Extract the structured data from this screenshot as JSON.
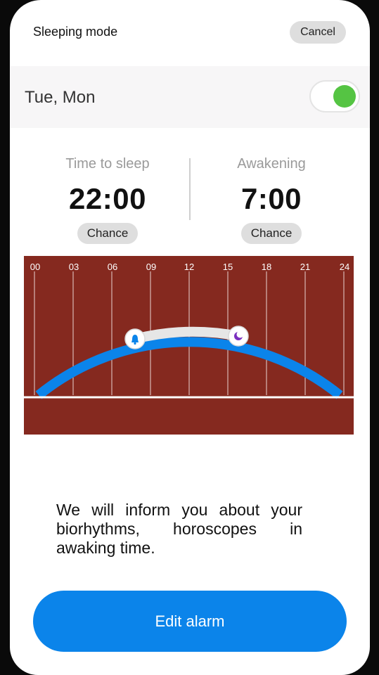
{
  "header": {
    "title": "Sleeping mode",
    "cancel_label": "Cancel"
  },
  "schedule": {
    "days": "Tue, Mon",
    "enabled": true,
    "toggle_color": "#55c443"
  },
  "sleep": {
    "label": "Time to sleep",
    "time": "22:00",
    "button_label": "Chance"
  },
  "wake": {
    "label": "Awakening",
    "time": "7:00",
    "button_label": "Chance"
  },
  "timeline": {
    "hour_labels": [
      "00",
      "03",
      "06",
      "09",
      "12",
      "15",
      "18",
      "21",
      "24"
    ],
    "background_color": "#85291f",
    "arc_color": "#0b84ea",
    "sleep_segment_color": "#e6e6e6",
    "markers": [
      {
        "icon": "bell-icon",
        "color": "#0b84ea"
      },
      {
        "icon": "moon-icon",
        "color": "#7b2fbf"
      }
    ]
  },
  "info": {
    "text": "We will inform you about your biorhythms, horoscopes in awaking time."
  },
  "action": {
    "edit_label": "Edit alarm",
    "color": "#0b84ea"
  }
}
